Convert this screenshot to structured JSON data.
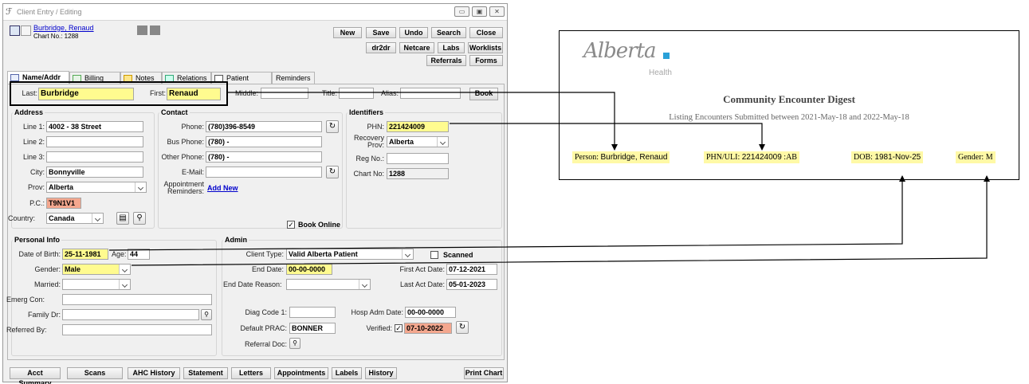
{
  "window": {
    "title": "Client Entry / Editing",
    "patient_name": "Burbridge, Renaud",
    "chart_no_label": "Chart No.: 1288",
    "win_min": "▭",
    "win_max": "▣",
    "win_close": "✕"
  },
  "toolbar": {
    "new": "New",
    "save": "Save",
    "undo": "Undo",
    "search": "Search",
    "close": "Close",
    "dr2dr": "dr2dr",
    "netcare": "Netcare",
    "labs": "Labs",
    "worklists": "Worklists",
    "referrals": "Referrals",
    "forms": "Forms"
  },
  "tabs": [
    "Name/Addr",
    "Billing",
    "Notes",
    "Relations",
    "Patient Portal",
    "Reminders"
  ],
  "name": {
    "last_label": "Last:",
    "last": "Burbridge",
    "first_label": "First:",
    "first": "Renaud",
    "middle_label": "Middle:",
    "title_label": "Title:",
    "alias_label": "Alias:",
    "book": "Book"
  },
  "address": {
    "title": "Address",
    "line1_label": "Line 1:",
    "line1": "4002 - 38 Street",
    "line2_label": "Line 2:",
    "line3_label": "Line 3:",
    "city_label": "City:",
    "city": "Bonnyville",
    "prov_label": "Prov:",
    "prov": "Alberta",
    "pc_label": "P.C.:",
    "pc": "T9N1V1",
    "country_label": "Country:",
    "country": "Canada"
  },
  "contact": {
    "title": "Contact",
    "phone_label": "Phone:",
    "phone": "(780)396-8549",
    "bus_label": "Bus Phone:",
    "bus": "(780)  -",
    "other_label": "Other Phone:",
    "other": "(780)  -",
    "email_label": "E-Mail:",
    "appt_label": "Appointment Reminders:",
    "add_new": "Add New",
    "book_online": "Book Online"
  },
  "identifiers": {
    "title": "Identifiers",
    "phn_label": "PHN:",
    "phn": "221424009",
    "recovery_label": "Recovery Prov:",
    "recovery": "Alberta",
    "reg_label": "Reg No.:",
    "chart_label": "Chart No:",
    "chart": "1288"
  },
  "personal": {
    "title": "Personal Info",
    "dob_label": "Date of Birth:",
    "dob": "25-11-1981",
    "age_label": "Age:",
    "age": "44",
    "gender_label": "Gender:",
    "gender": "Male",
    "married_label": "Married:",
    "emerg_label": "Emerg Con:",
    "family_label": "Family Dr:",
    "referred_label": "Referred By:"
  },
  "admin": {
    "title": "Admin",
    "client_type_label": "Client Type:",
    "client_type": "Valid Alberta Patient",
    "scanned": "Scanned",
    "end_date_label": "End Date:",
    "end_date": "00-00-0000",
    "first_act_label": "First Act Date:",
    "first_act": "07-12-2021",
    "end_reason_label": "End Date Reason:",
    "last_act_label": "Last Act Date:",
    "last_act": "05-01-2023",
    "diag_label": "Diag Code 1:",
    "hosp_label": "Hosp Adm Date:",
    "hosp": "00-00-0000",
    "prac_label": "Default PRAC:",
    "prac": "BONNER",
    "verified_label": "Verified:",
    "verified": "07-10-2022",
    "referral_label": "Referral Doc:"
  },
  "bottom": [
    "Acct Summary",
    "Scans",
    "AHC History",
    "Statement",
    "Letters",
    "Appointments",
    "Labels",
    "History",
    "Print Chart"
  ],
  "digest": {
    "logo": "Alberta",
    "logo_sub": "Health",
    "title": "Community Encounter Digest",
    "subtitle": "Listing Encounters Submitted between 2021-May-18 and 2022-May-18",
    "person_label": "Person:",
    "person": "Burbridge, Renaud",
    "phn_label": "PHN/ULI:",
    "phn": "221424009",
    "phn_suffix": ":AB",
    "dob_label": "DOB:",
    "dob": "1981-Nov-25",
    "gender_label": "Gender:",
    "gender": "M"
  },
  "colors": {
    "highlight": "#fffb8f",
    "salmon": "#f4a78e",
    "link": "#0000cc",
    "logo_blue": "#2aa1d8"
  }
}
